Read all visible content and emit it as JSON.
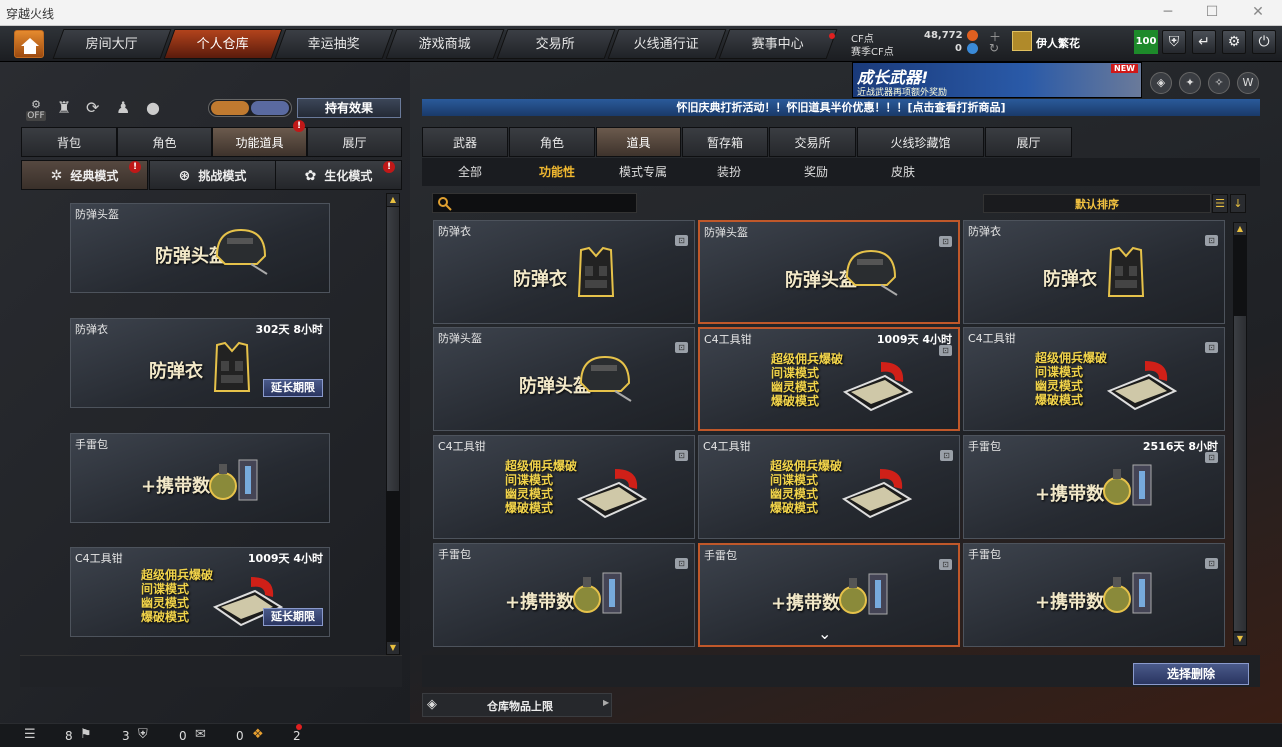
{
  "window": {
    "title": "穿越火线"
  },
  "nav": {
    "tabs": [
      "房间大厅",
      "个人仓库",
      "幸运抽奖",
      "游戏商城",
      "交易所",
      "火线通行证",
      "赛事中心"
    ],
    "active": "个人仓库",
    "cf_label": "CF点",
    "cf_value": "48,772",
    "season_cf_label": "赛季CF点",
    "season_cf_value": "0",
    "username": "伊人繁花",
    "level": "100"
  },
  "banner": {
    "title": "成长武器!",
    "subtitle": "近战武器再项额外奖励",
    "badge": "NEW"
  },
  "left": {
    "icon_off": "OFF",
    "effect_button": "持有效果",
    "tabs": [
      "背包",
      "角色",
      "功能道具",
      "展厅"
    ],
    "active_tab": "功能道具",
    "modes": [
      "经典模式",
      "挑战模式",
      "生化模式"
    ],
    "active_mode": "经典模式",
    "items": [
      {
        "name": "防弹头盔",
        "duration": "",
        "big": "防弹头盔",
        "extend": ""
      },
      {
        "name": "防弹衣",
        "duration": "302天 8小时",
        "big": "防弹衣",
        "extend": "延长期限"
      },
      {
        "name": "手雷包",
        "duration": "",
        "big": "+携带数",
        "extend": ""
      },
      {
        "name": "C4工具钳",
        "duration": "1009天 4小时",
        "modes": [
          "超级佣兵爆破",
          "间谍模式",
          "幽灵模式",
          "爆破模式"
        ],
        "extend": "延长期限"
      }
    ]
  },
  "right": {
    "notice": "怀旧庆典打折活动！！怀旧道具半价优惠！！！[点击查看打折商品]",
    "tabs": [
      "武器",
      "角色",
      "道具",
      "暂存箱",
      "交易所",
      "火线珍藏馆",
      "展厅"
    ],
    "active_tab": "道具",
    "subtabs": [
      "全部",
      "功能性",
      "模式专属",
      "装扮",
      "奖励",
      "皮肤"
    ],
    "active_subtab": "功能性",
    "search_placeholder": "",
    "sort_label": "默认排序",
    "items": [
      {
        "name": "防弹衣",
        "duration": "",
        "big": "防弹衣"
      },
      {
        "name": "防弹头盔",
        "duration": "",
        "big": "防弹头盔"
      },
      {
        "name": "防弹衣",
        "duration": "",
        "big": "防弹衣"
      },
      {
        "name": "防弹头盔",
        "duration": "",
        "big": "防弹头盔"
      },
      {
        "name": "C4工具钳",
        "duration": "1009天 4小时",
        "modes": [
          "超级佣兵爆破",
          "间谍模式",
          "幽灵模式",
          "爆破模式"
        ]
      },
      {
        "name": "C4工具钳",
        "duration": "",
        "modes": [
          "超级佣兵爆破",
          "间谍模式",
          "幽灵模式",
          "爆破模式"
        ]
      },
      {
        "name": "C4工具钳",
        "duration": "",
        "modes": [
          "超级佣兵爆破",
          "间谍模式",
          "幽灵模式",
          "爆破模式"
        ]
      },
      {
        "name": "C4工具钳",
        "duration": "",
        "modes": [
          "超级佣兵爆破",
          "间谍模式",
          "幽灵模式",
          "爆破模式"
        ]
      },
      {
        "name": "手雷包",
        "duration": "2516天 8小时",
        "big": "+携带数"
      },
      {
        "name": "手雷包",
        "duration": "",
        "big": "+携带数"
      },
      {
        "name": "手雷包",
        "duration": "",
        "big": "+携带数"
      },
      {
        "name": "手雷包",
        "duration": "",
        "big": "+携带数"
      }
    ],
    "select_delete": "选择删除",
    "warehouse_limit": "仓库物品上限"
  },
  "statusbar": {
    "bag_count": "8",
    "shield_count": "3",
    "chat_count": "0",
    "gift_count": "0",
    "notify_count": "2"
  }
}
